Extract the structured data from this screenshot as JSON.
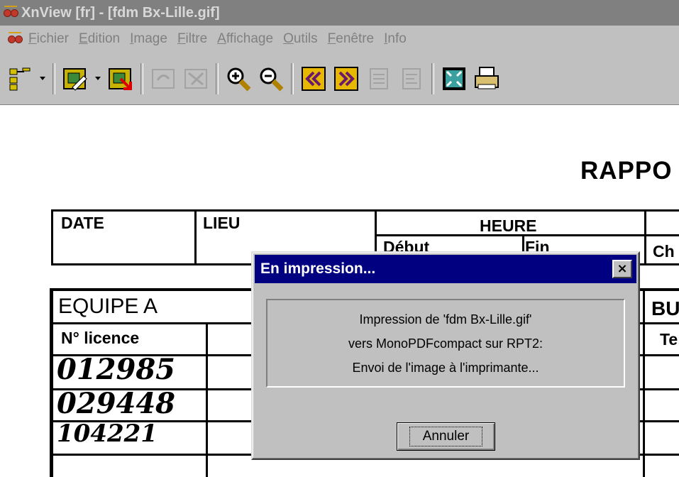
{
  "window": {
    "title": "XnView [fr] - [fdm Bx-Lille.gif]"
  },
  "menubar": {
    "items": [
      {
        "label": "Fichier"
      },
      {
        "label": "Edition"
      },
      {
        "label": "Image"
      },
      {
        "label": "Filtre"
      },
      {
        "label": "Affichage"
      },
      {
        "label": "Outils"
      },
      {
        "label": "Fenêtre"
      },
      {
        "label": "Info"
      }
    ]
  },
  "toolbar": {
    "buttons": [
      {
        "icon": "tree-view-icon"
      },
      {
        "icon": "open-icon"
      },
      {
        "icon": "save-icon"
      },
      {
        "icon": "undo-icon"
      },
      {
        "icon": "redo-icon"
      },
      {
        "icon": "zoom-in-icon"
      },
      {
        "icon": "zoom-out-icon"
      },
      {
        "icon": "previous-icon"
      },
      {
        "icon": "next-icon"
      },
      {
        "icon": "first-page-icon"
      },
      {
        "icon": "last-page-icon"
      },
      {
        "icon": "fullscreen-icon"
      },
      {
        "icon": "print-icon"
      }
    ]
  },
  "document": {
    "title": "RAPPO",
    "labels": {
      "date": "DATE",
      "lieu": "LIEU",
      "heure": "HEURE",
      "debut": "Début",
      "fin": "Fin",
      "ch": "Ch",
      "equipe": "EQUIPE A",
      "licence": "N° licence",
      "bu": "BU",
      "te": "Te"
    },
    "handwriting": [
      "012985",
      "029448",
      "104221"
    ]
  },
  "dialog": {
    "title": "En impression...",
    "close": "×",
    "lines": [
      "Impression de 'fdm Bx-Lille.gif'",
      "vers MonoPDFcompact sur RPT2:",
      "Envoi de l'image à l'imprimante..."
    ],
    "button": "Annuler"
  },
  "colors": {
    "dialog_title_bg": "#000080",
    "chrome": "#c0c0c0",
    "inactive_title": "#808080"
  }
}
